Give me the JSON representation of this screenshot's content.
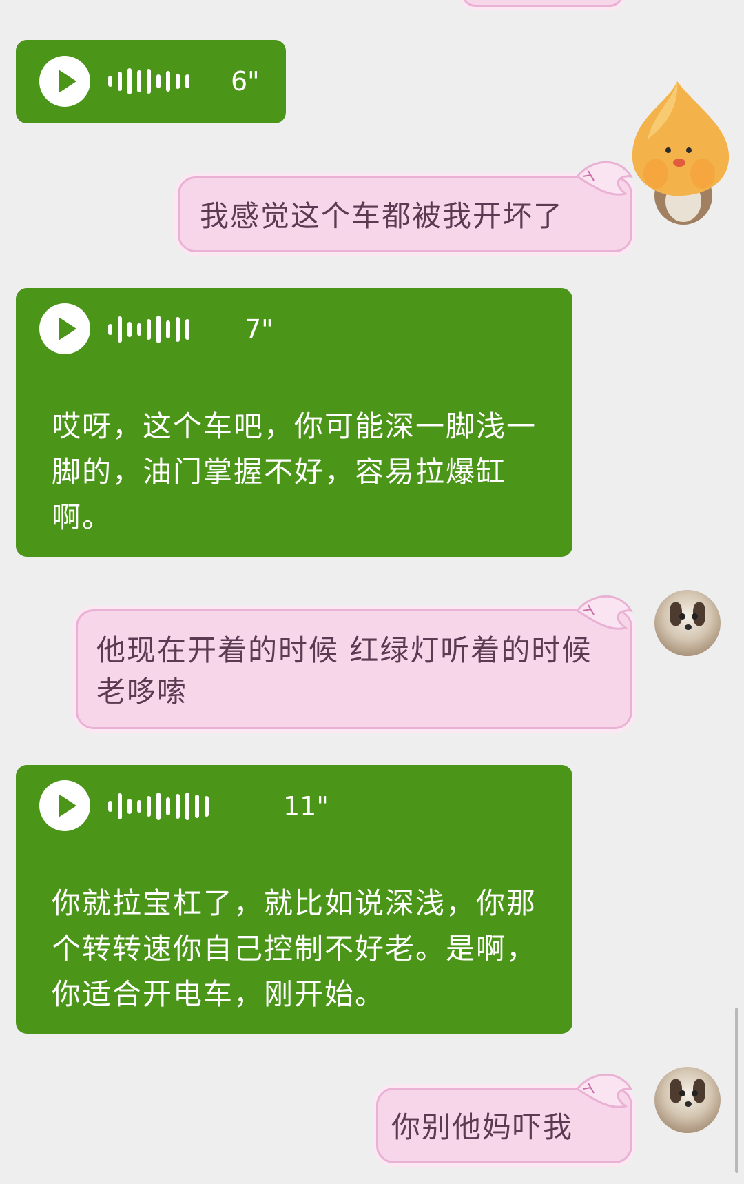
{
  "colors": {
    "background": "#eeeeee",
    "voice_bubble": "#4b9519",
    "sent_bubble": "#f7d6ea",
    "sent_text": "#5b3a52"
  },
  "messages": [
    {
      "type": "voice",
      "duration": "6\""
    },
    {
      "type": "sent",
      "text": "我感觉这个车都被我开坏了"
    },
    {
      "type": "voice",
      "duration": "7\"",
      "transcript": "哎呀，这个车吧，你可能深一脚浅一脚的，油门掌握不好，容易拉爆缸啊。"
    },
    {
      "type": "sent",
      "text": "他现在开着的时候 红绿灯听着的时候 老哆嗦"
    },
    {
      "type": "voice",
      "duration": "11\"",
      "transcript": "你就拉宝杠了，就比如说深浅，你那个转转速你自己控制不好老。是啊，你适合开电车，刚开始。"
    },
    {
      "type": "sent",
      "text": "你别他妈吓我"
    }
  ],
  "icons": {
    "play": "play-icon",
    "waveform": "waveform-icon",
    "avatar": "dog-ghost-avatar",
    "sticker": "peach-sticker"
  }
}
